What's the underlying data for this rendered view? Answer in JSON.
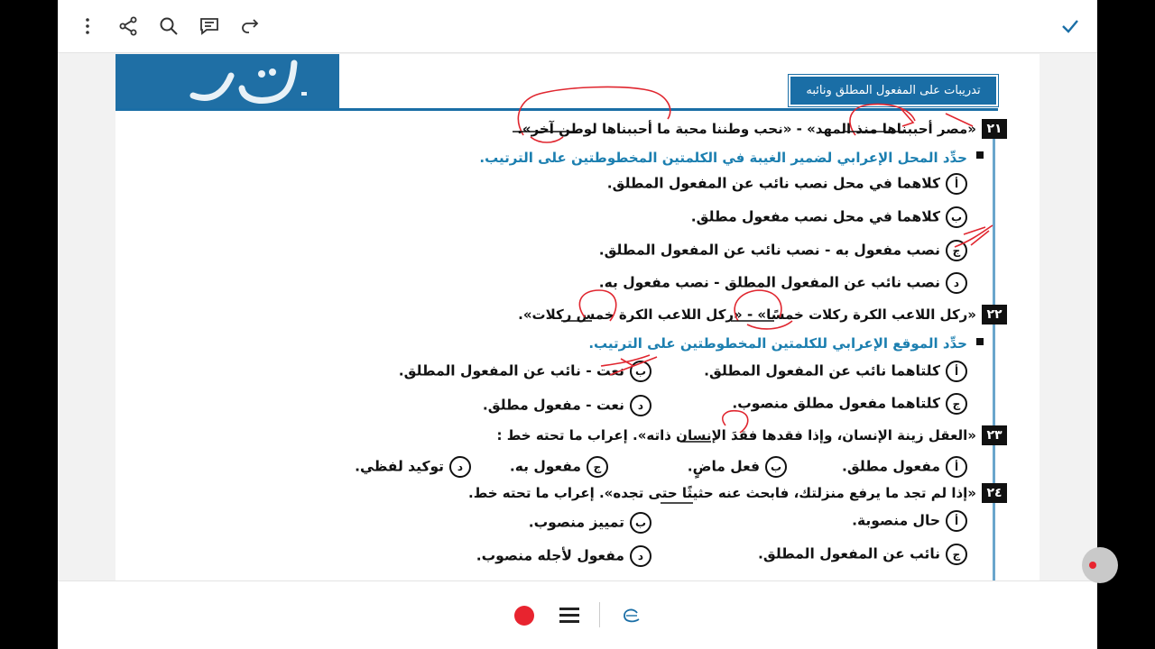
{
  "topbar": {
    "more_icon": "more-vertical-icon",
    "share_icon": "share-icon",
    "search_icon": "search-icon",
    "comment_icon": "comment-icon",
    "redo_icon": "redo-icon",
    "done_icon": "check-icon",
    "accent": "#1a6ea6"
  },
  "doc": {
    "banner_chip": "تدريبات على المفعول المطلق ونائبه",
    "questions": [
      {
        "number": "٢١",
        "text": "«مصر أحببناها منذ المهد» - «نحب وطننا محبة ما أحببناها لوطن آخر».",
        "instruction": "حدِّد المحل الإعرابي لضمير الغيبة في الكلمتين المخطوطتين على الترتيب.",
        "options": [
          {
            "letter": "أ",
            "text": "كلاهما في محل نصب نائب عن المفعول المطلق."
          },
          {
            "letter": "ب",
            "text": "كلاهما في محل نصب مفعول مطلق."
          },
          {
            "letter": "ج",
            "text": "نصب مفعول به - نصب نائب عن المفعول المطلق."
          },
          {
            "letter": "د",
            "text": "نصب نائب عن المفعول المطلق - نصب مفعول به."
          }
        ]
      },
      {
        "number": "٢٢",
        "text": "«ركل اللاعب الكرة ركلات خمسًا» - «ركل اللاعب الكرة خمس ركلات».",
        "instruction": "حدِّد الموقع الإعرابي للكلمتين المخطوطتين على الترتيب.",
        "options": [
          {
            "letter": "أ",
            "text": "كلتاهما نائب عن المفعول المطلق."
          },
          {
            "letter": "ب",
            "text": "نعت - نائب عن المفعول المطلق."
          },
          {
            "letter": "ج",
            "text": "كلتاهما مفعول مطلق منصوب."
          },
          {
            "letter": "د",
            "text": "نعت - مفعول مطلق."
          }
        ]
      },
      {
        "number": "٢٣",
        "text": "«العقل زينة الإنسان، وإذا فقدها فقدَ الإنسان ذاته». إعراب ما تحته خط :",
        "options": [
          {
            "letter": "أ",
            "text": "مفعول مطلق."
          },
          {
            "letter": "ب",
            "text": "فعل ماضٍ."
          },
          {
            "letter": "ج",
            "text": "مفعول به."
          },
          {
            "letter": "د",
            "text": "توكيد لفظي."
          }
        ]
      },
      {
        "number": "٢٤",
        "text": "«إذا لم تجد ما يرفع منزلتك، فابحث عنه حثيثًا حتى تجده». إعراب ما تحته خط.",
        "options": [
          {
            "letter": "أ",
            "text": "حال منصوبة."
          },
          {
            "letter": "ب",
            "text": "تمييز منصوب."
          },
          {
            "letter": "ج",
            "text": "نائب عن المفعول المطلق."
          },
          {
            "letter": "د",
            "text": "مفعول لأجله منصوب."
          }
        ]
      }
    ]
  },
  "bottombar": {
    "record_color": "#e8242f",
    "menu_icon": "hamburger-menu-icon",
    "eraser_icon": "eraser-icon"
  }
}
